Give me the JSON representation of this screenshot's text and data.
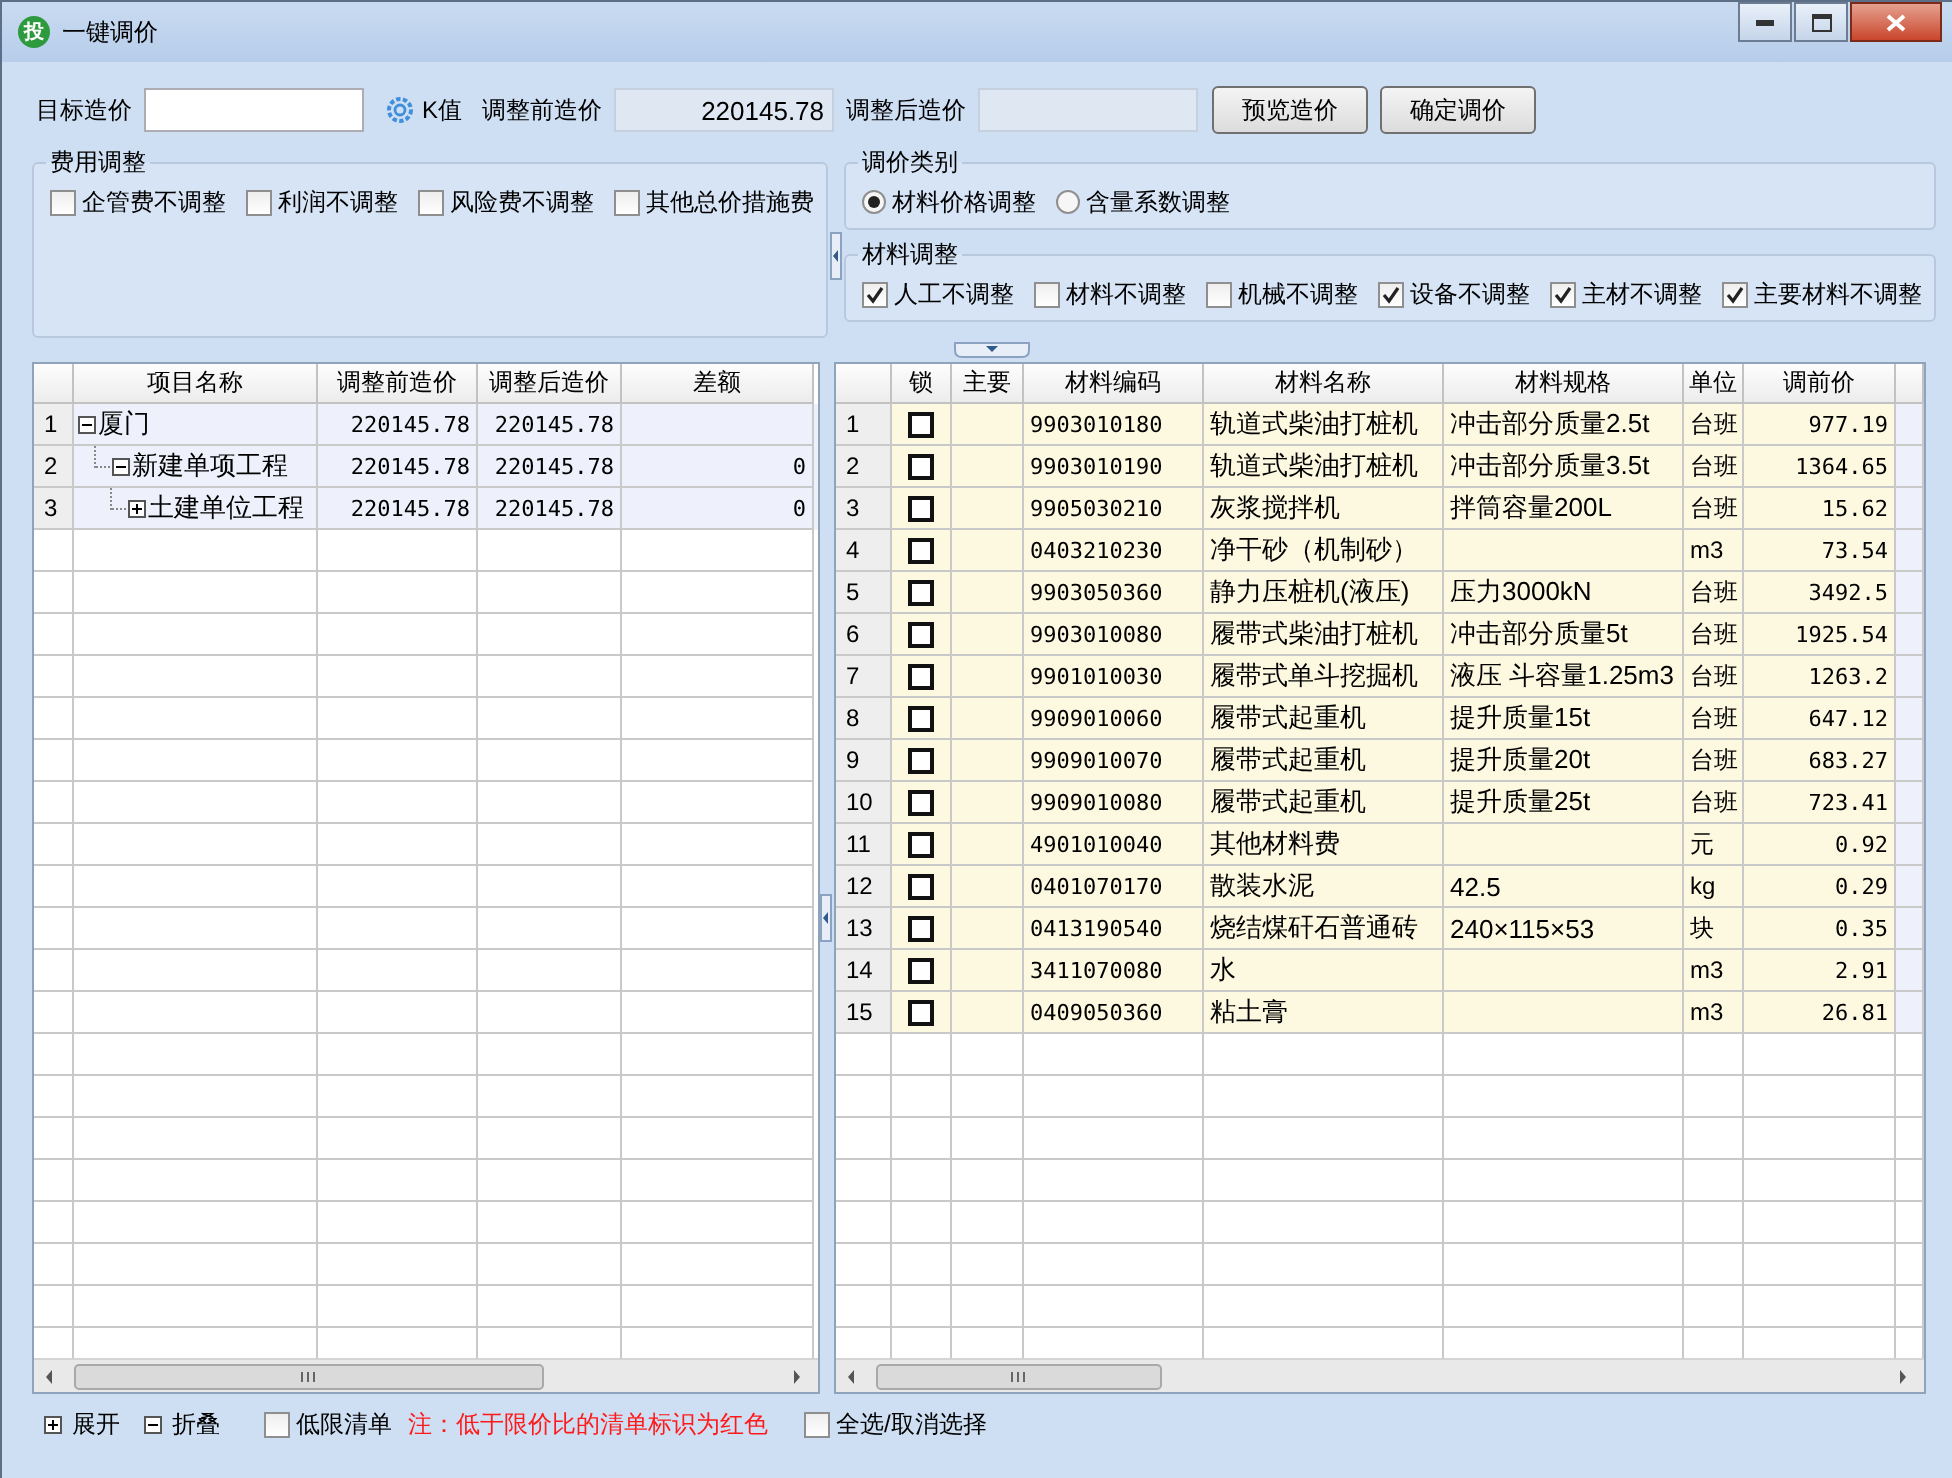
{
  "window": {
    "icon_text": "投",
    "title": "一键调价"
  },
  "top_form": {
    "target_label": "目标造价",
    "k_label": "K值",
    "before_label": "调整前造价",
    "before_value": "220145.78",
    "after_label": "调整后造价",
    "buttons": [
      "预览造价",
      "确定调价"
    ]
  },
  "fee_adjust": {
    "title": "费用调整",
    "options": [
      {
        "label": "企管费不调整",
        "checked": false
      },
      {
        "label": "利润不调整",
        "checked": false
      },
      {
        "label": "风险费不调整",
        "checked": false
      },
      {
        "label": "其他总价措施费",
        "checked": false
      }
    ]
  },
  "adjust_type": {
    "title": "调价类别",
    "options": [
      {
        "label": "材料价格调整",
        "selected": true
      },
      {
        "label": "含量系数调整",
        "selected": false
      }
    ]
  },
  "material_adjust": {
    "title": "材料调整",
    "options": [
      {
        "label": "人工不调整",
        "checked": true
      },
      {
        "label": "材料不调整",
        "checked": false
      },
      {
        "label": "机械不调整",
        "checked": false
      },
      {
        "label": "设备不调整",
        "checked": true
      },
      {
        "label": "主材不调整",
        "checked": true
      },
      {
        "label": "主要材料不调整",
        "checked": true
      }
    ]
  },
  "project_table": {
    "columns": [
      "项目名称",
      "调整前造价",
      "调整后造价",
      "差额"
    ],
    "rows": [
      {
        "index": "1",
        "name": "厦门",
        "before": "220145.78",
        "after": "220145.78",
        "expanded": true,
        "children": [
          {
            "index": "2",
            "name": "新建单项工程",
            "before": "220145.78",
            "after": "220145.78",
            "diff": "0",
            "expanded": true,
            "children": [
              {
                "index": "3",
                "name": "土建单位工程",
                "before": "220145.78",
                "after": "220145.78",
                "diff": "0",
                "expanded": false
              }
            ]
          }
        ]
      }
    ]
  },
  "material_table": {
    "columns": [
      "锁",
      "主要",
      "材料编码",
      "材料名称",
      "材料规格",
      "单位",
      "调前价"
    ],
    "rows": [
      {
        "index": "1",
        "locked": false,
        "code": "9903010180",
        "name": "轨道式柴油打桩机",
        "spec": "冲击部分质量2.5t",
        "unit": "台班",
        "price": "977.19"
      },
      {
        "index": "2",
        "locked": false,
        "code": "9903010190",
        "name": "轨道式柴油打桩机",
        "spec": "冲击部分质量3.5t",
        "unit": "台班",
        "price": "1364.65"
      },
      {
        "index": "3",
        "locked": false,
        "code": "9905030210",
        "name": "灰浆搅拌机",
        "spec": "拌筒容量200L",
        "unit": "台班",
        "price": "15.62"
      },
      {
        "index": "4",
        "locked": false,
        "code": "0403210230",
        "name": "净干砂（机制砂）",
        "unit": "m3",
        "price": "73.54"
      },
      {
        "index": "5",
        "locked": false,
        "code": "9903050360",
        "name": "静力压桩机(液压)",
        "spec": "压力3000kN",
        "unit": "台班",
        "price": "3492.5"
      },
      {
        "index": "6",
        "locked": false,
        "code": "9903010080",
        "name": "履带式柴油打桩机",
        "spec": "冲击部分质量5t",
        "unit": "台班",
        "price": "1925.54"
      },
      {
        "index": "7",
        "locked": false,
        "code": "9901010030",
        "name": "履带式单斗挖掘机",
        "spec": "液压 斗容量1.25m3",
        "unit": "台班",
        "price": "1263.2"
      },
      {
        "index": "8",
        "locked": false,
        "code": "9909010060",
        "name": "履带式起重机",
        "spec": "提升质量15t",
        "unit": "台班",
        "price": "647.12"
      },
      {
        "index": "9",
        "locked": false,
        "code": "9909010070",
        "name": "履带式起重机",
        "spec": "提升质量20t",
        "unit": "台班",
        "price": "683.27"
      },
      {
        "index": "10",
        "locked": false,
        "code": "9909010080",
        "name": "履带式起重机",
        "spec": "提升质量25t",
        "unit": "台班",
        "price": "723.41"
      },
      {
        "index": "11",
        "locked": false,
        "code": "4901010040",
        "name": "其他材料费",
        "unit": "元",
        "price": "0.92"
      },
      {
        "index": "12",
        "locked": false,
        "code": "0401070170",
        "name": "散装水泥",
        "spec": "42.5",
        "unit": "kg",
        "price": "0.29"
      },
      {
        "index": "13",
        "locked": false,
        "code": "0413190540",
        "name": "烧结煤矸石普通砖",
        "spec": "240×115×53",
        "unit": "块",
        "price": "0.35"
      },
      {
        "index": "14",
        "locked": false,
        "code": "3411070080",
        "name": "水",
        "unit": "m3",
        "price": "2.91"
      },
      {
        "index": "15",
        "locked": false,
        "code": "0409050360",
        "name": "粘土膏",
        "unit": "m3",
        "price": "26.81"
      }
    ]
  },
  "bottom_bar": {
    "expand": "展开",
    "collapse": "折叠",
    "low_limit": {
      "label": "低限清单",
      "checked": false
    },
    "note": "注：低于限价比的清单标识为红色",
    "select_all": {
      "label": "全选/取消选择",
      "checked": false
    }
  }
}
